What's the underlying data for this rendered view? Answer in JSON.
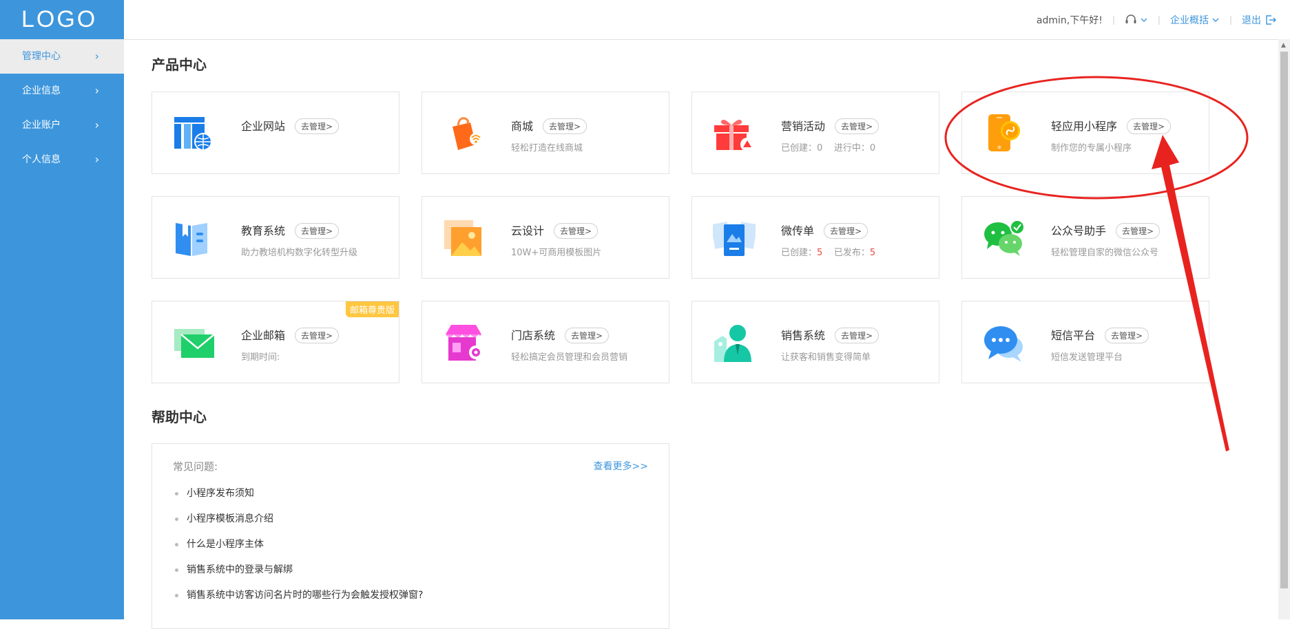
{
  "logo": "LOGO",
  "sidebar": {
    "items": [
      {
        "label": "管理中心"
      },
      {
        "label": "企业信息"
      },
      {
        "label": "企业账户"
      },
      {
        "label": "个人信息"
      }
    ]
  },
  "header": {
    "greeting": "admin,下午好!",
    "overview_label": "企业概括",
    "logout_label": "退出"
  },
  "products": {
    "title": "产品中心",
    "manage_label": "去管理>",
    "cards": [
      {
        "name": "企业网站",
        "desc": ""
      },
      {
        "name": "商城",
        "desc": "轻松打造在线商城"
      },
      {
        "name": "营销活动",
        "created_label": "已创建：",
        "created": "0",
        "running_label": "进行中：",
        "running": "0"
      },
      {
        "name": "轻应用小程序",
        "desc": "制作您的专属小程序"
      },
      {
        "name": "教育系统",
        "desc": "助力教培机构数字化转型升级"
      },
      {
        "name": "云设计",
        "desc": "10W+可商用模板图片"
      },
      {
        "name": "微传单",
        "created_label": "已创建：",
        "created": "5",
        "published_label": "已发布：",
        "published": "5"
      },
      {
        "name": "公众号助手",
        "desc": "轻松管理自家的微信公众号"
      },
      {
        "name": "企业邮箱",
        "desc": "到期时间:",
        "badge": "邮箱尊贵版"
      },
      {
        "name": "门店系统",
        "desc": "轻松搞定会员管理和会员营销"
      },
      {
        "name": "销售系统",
        "desc": "让获客和销售变得简单"
      },
      {
        "name": "短信平台",
        "desc": "短信发送管理平台"
      }
    ]
  },
  "help": {
    "title": "帮助中心",
    "faq_title": "常见问题:",
    "more_label": "查看更多>>",
    "faq": [
      "小程序发布须知",
      "小程序模板消息介绍",
      "什么是小程序主体",
      "销售系统中的登录与解绑",
      "销售系统中访客访问名片时的哪些行为会触发授权弹窗?"
    ]
  },
  "colors": {
    "sidebar": "#3d96dc",
    "accent": "#3d96dc",
    "badge": "#ffc640",
    "highlight": "#e84a3f",
    "annotation": "#e8231f"
  }
}
